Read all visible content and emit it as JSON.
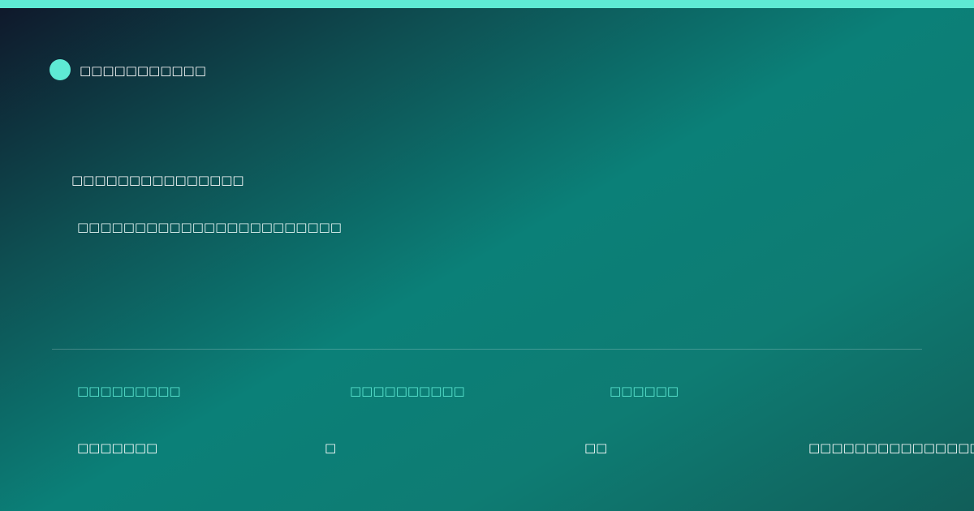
{
  "colors": {
    "accent": "#5eead4",
    "background_start": "#0f172a",
    "background_mid": "#0b8078",
    "background_end": "#115e59",
    "text": "#ffffff"
  },
  "brand": {
    "icon": "brand-dot-icon",
    "name": "□□□□□□□□□□□"
  },
  "hero": {
    "headline": "□□□□□□□□□□□□□□□",
    "subheadline": "□□□□□□□□□□□□□□□□□□□□□□□"
  },
  "stats": [
    {
      "label": "□□□□□□□□□",
      "value": "□□□□□□□"
    },
    {
      "label": "□□□□□□□□□□",
      "value": "□"
    },
    {
      "label": "□□□□□□",
      "value": "□□"
    }
  ],
  "footer": {
    "note": "□□□□□□□□□□□□□□□"
  }
}
